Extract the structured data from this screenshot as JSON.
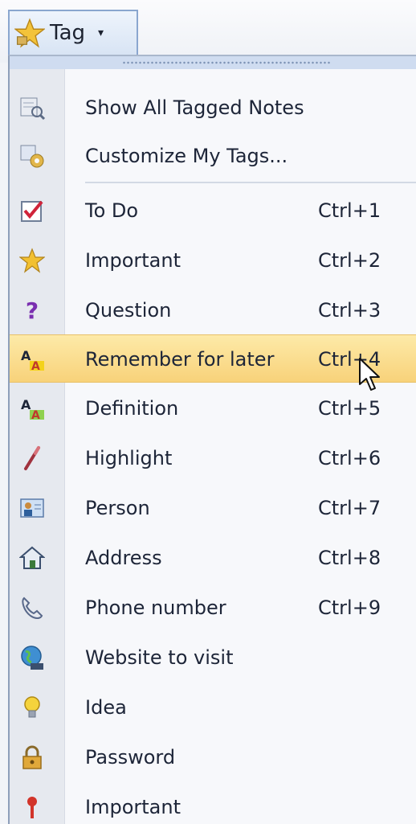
{
  "toolbar": {
    "tag_button": {
      "label": "Tag",
      "icon": "star-tag-icon",
      "caret": "▾"
    }
  },
  "menu": {
    "actions": [
      {
        "label": "Show All Tagged Notes",
        "icon": "tagged-notes-icon"
      },
      {
        "label": "Customize My Tags...",
        "icon": "customize-tags-icon"
      }
    ],
    "tags": [
      {
        "label": "To Do",
        "shortcut": "Ctrl+1",
        "icon": "checkbox-icon"
      },
      {
        "label": "Important",
        "shortcut": "Ctrl+2",
        "icon": "star-icon"
      },
      {
        "label": "Question",
        "shortcut": "Ctrl+3",
        "icon": "question-icon"
      },
      {
        "label": "Remember for later",
        "shortcut": "Ctrl+4",
        "icon": "highlight-text-icon",
        "state": "hovered"
      },
      {
        "label": "Definition",
        "shortcut": "Ctrl+5",
        "icon": "definition-icon"
      },
      {
        "label": "Highlight",
        "shortcut": "Ctrl+6",
        "icon": "highlighter-icon"
      },
      {
        "label": "Person",
        "shortcut": "Ctrl+7",
        "icon": "person-card-icon"
      },
      {
        "label": "Address",
        "shortcut": "Ctrl+8",
        "icon": "house-icon"
      },
      {
        "label": "Phone number",
        "shortcut": "Ctrl+9",
        "icon": "phone-icon"
      },
      {
        "label": "Website to visit",
        "shortcut": "",
        "icon": "globe-icon"
      },
      {
        "label": "Idea",
        "shortcut": "",
        "icon": "lightbulb-icon"
      },
      {
        "label": "Password",
        "shortcut": "",
        "icon": "lock-icon"
      },
      {
        "label": "Important",
        "shortcut": "",
        "icon": "exclamation-icon"
      }
    ]
  },
  "colors": {
    "highlight": "#f8d27a",
    "menu_border": "#8aa6cf",
    "gutter": "#e6e9ef"
  }
}
